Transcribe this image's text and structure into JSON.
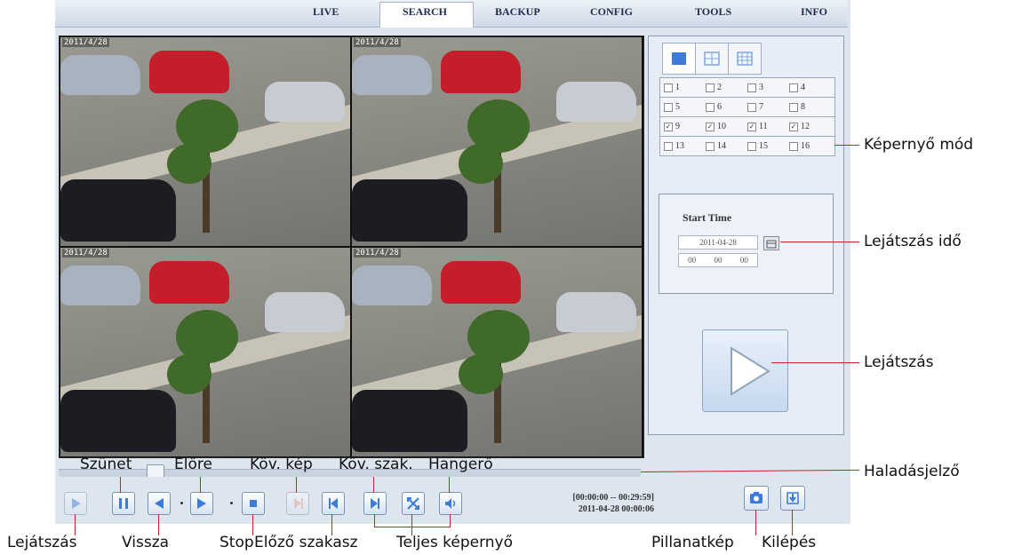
{
  "menu": {
    "tabs": [
      "LIVE",
      "SEARCH",
      "BACKUP",
      "CONFIG",
      "TOOLS",
      "INFO"
    ],
    "active": "SEARCH"
  },
  "video": {
    "tiles": [
      {
        "stamp": "2011/4/28"
      },
      {
        "stamp": "2011/4/28"
      },
      {
        "stamp": "2011/4/28"
      },
      {
        "stamp": "2011/4/28"
      }
    ]
  },
  "channels": {
    "rows": [
      [
        {
          "n": "1",
          "checked": false
        },
        {
          "n": "2",
          "checked": false
        },
        {
          "n": "3",
          "checked": false
        },
        {
          "n": "4",
          "checked": false
        }
      ],
      [
        {
          "n": "5",
          "checked": false
        },
        {
          "n": "6",
          "checked": false
        },
        {
          "n": "7",
          "checked": false
        },
        {
          "n": "8",
          "checked": false
        }
      ],
      [
        {
          "n": "9",
          "checked": true
        },
        {
          "n": "10",
          "checked": true
        },
        {
          "n": "11",
          "checked": true
        },
        {
          "n": "12",
          "checked": true
        }
      ],
      [
        {
          "n": "13",
          "checked": false
        },
        {
          "n": "14",
          "checked": false
        },
        {
          "n": "15",
          "checked": false
        },
        {
          "n": "16",
          "checked": false
        }
      ]
    ]
  },
  "start_time": {
    "title": "Start Time",
    "date": "2011-04-28",
    "hh": "00",
    "mm": "00",
    "ss": "00"
  },
  "status": {
    "range": "[00:00:00 -- 00:29:59]",
    "datetime": "2011-04-28 00:00:06"
  },
  "annotations": {
    "top": [
      "Szünet",
      "Előre",
      "Köv. kép",
      "Köv. szak.",
      "Hangerő"
    ],
    "bottom": [
      "Lejátszás",
      "Vissza",
      "Stop",
      "Előző szakasz",
      "Teljes képernyő",
      "Pillanatkép",
      "Kilépés"
    ],
    "right": [
      "Képernyő mód",
      "Lejátszás idő",
      "Lejátszás",
      "Haladásjelző"
    ]
  },
  "colors": {
    "accent": "#3d7bd8",
    "leader": "#cc2222"
  },
  "icons": [
    "play-icon",
    "pause-icon",
    "rewind-icon",
    "forward-icon",
    "stop-icon",
    "next-frame-icon",
    "prev-segment-icon",
    "next-segment-icon",
    "fullscreen-icon",
    "volume-icon",
    "camera-icon",
    "exit-icon",
    "calendar-icon"
  ]
}
